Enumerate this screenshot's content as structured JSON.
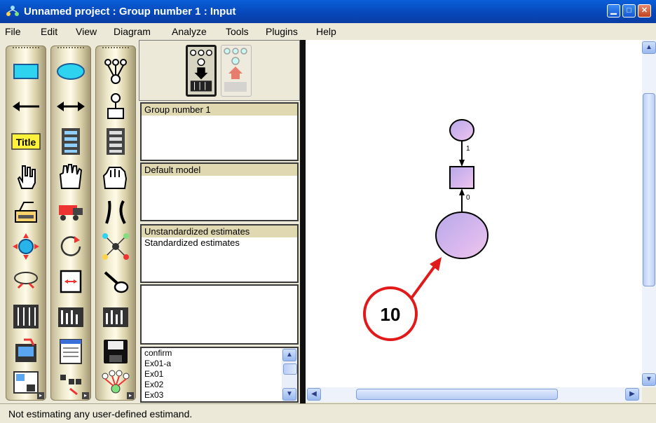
{
  "window": {
    "title": "Unnamed project : Group number 1 : Input"
  },
  "menu": [
    "File",
    "Edit",
    "View",
    "Diagram",
    "Analyze",
    "Tools",
    "Plugins",
    "Help"
  ],
  "toolbox": {
    "tools": [
      "draw-observed-variable-icon",
      "draw-latent-variable-icon",
      "draw-latent-with-indicators-icon",
      "draw-path-icon",
      "draw-covariance-icon",
      "add-unique-variable-icon",
      "figure-caption-icon",
      "list-variables-in-model-icon",
      "list-variables-in-dataset-icon",
      "select-one-object-icon",
      "select-all-objects-icon",
      "deselect-all-objects-icon",
      "duplicate-objects-icon",
      "move-objects-icon",
      "erase-objects-icon",
      "change-shape-icon",
      "rotate-indicators-icon",
      "reflect-indicators-icon",
      "move-parameters-icon",
      "scroll-diagram-icon",
      "touch-up-variable-icon",
      "select-data-files-icon",
      "analysis-properties-icon",
      "calculate-estimates-icon",
      "copy-diagram-icon",
      "view-text-output-icon",
      "save-diagram-icon",
      "object-properties-icon",
      "drag-properties-icon",
      "preserve-symmetries-icon"
    ]
  },
  "panels": {
    "groups": {
      "header": "Group number 1"
    },
    "models": {
      "header": "Default model"
    },
    "estimates": {
      "items": [
        "Unstandardized estimates",
        "Standardized estimates"
      ]
    },
    "files": [
      "confirm",
      "Ex01-a",
      "Ex01",
      "Ex02",
      "Ex03"
    ]
  },
  "diagram": {
    "path_labels": [
      "1",
      "0"
    ],
    "callout": "10",
    "colors": {
      "accent": "#e11919",
      "node_fill": "#d9b8ee"
    }
  },
  "status": {
    "text": "Not estimating any user-defined estimand."
  }
}
